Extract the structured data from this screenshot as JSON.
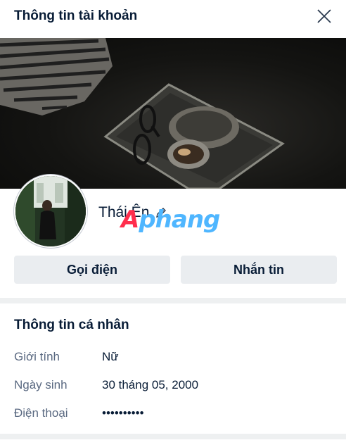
{
  "header": {
    "title": "Thông tin tài khoản",
    "close_icon": "close-icon"
  },
  "profile": {
    "name": "Thái Ên",
    "edit_icon": "pencil-icon",
    "call_label": "Gọi điện",
    "message_label": "Nhắn tin"
  },
  "watermark": {
    "first": "A",
    "rest": "phang"
  },
  "personal_info": {
    "title": "Thông tin cá nhân",
    "rows": [
      {
        "label": "Giới tính",
        "value": "Nữ"
      },
      {
        "label": "Ngày sinh",
        "value": "30 tháng 05, 2000"
      },
      {
        "label": "Điện thoại",
        "value": "••••••••••"
      }
    ]
  },
  "colors": {
    "text": "#081c36",
    "muted": "#5a6981",
    "button_bg": "#eaedf0",
    "divider": "#eef0f1"
  }
}
